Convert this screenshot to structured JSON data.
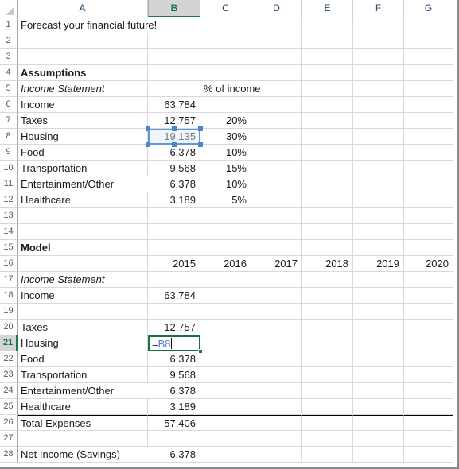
{
  "grid": {
    "columns": [
      {
        "label": "A",
        "active": false
      },
      {
        "label": "B",
        "active": true
      },
      {
        "label": "C",
        "active": false
      },
      {
        "label": "D",
        "active": false
      },
      {
        "label": "E",
        "active": false
      },
      {
        "label": "F",
        "active": false
      },
      {
        "label": "G",
        "active": false
      }
    ],
    "rows": [
      {
        "label": "1",
        "active": false
      },
      {
        "label": "2",
        "active": false
      },
      {
        "label": "3",
        "active": false
      },
      {
        "label": "4",
        "active": false
      },
      {
        "label": "5",
        "active": false
      },
      {
        "label": "6",
        "active": false
      },
      {
        "label": "7",
        "active": false
      },
      {
        "label": "8",
        "active": false
      },
      {
        "label": "9",
        "active": false
      },
      {
        "label": "10",
        "active": false
      },
      {
        "label": "11",
        "active": false
      },
      {
        "label": "12",
        "active": false
      },
      {
        "label": "13",
        "active": false
      },
      {
        "label": "14",
        "active": false
      },
      {
        "label": "15",
        "active": false
      },
      {
        "label": "16",
        "active": false
      },
      {
        "label": "17",
        "active": false
      },
      {
        "label": "18",
        "active": false
      },
      {
        "label": "19",
        "active": false
      },
      {
        "label": "20",
        "active": false
      },
      {
        "label": "21",
        "active": true
      },
      {
        "label": "22",
        "active": false
      },
      {
        "label": "23",
        "active": false
      },
      {
        "label": "24",
        "active": false
      },
      {
        "label": "25",
        "active": false
      },
      {
        "label": "26",
        "active": false
      },
      {
        "label": "27",
        "active": false
      },
      {
        "label": "28",
        "active": false
      }
    ]
  },
  "cells": {
    "A1": "Forecast your financial future!",
    "A4": "Assumptions",
    "A5": "Income Statement",
    "C5": "% of income",
    "A6": "Income",
    "B6": "63,784",
    "A7": "Taxes",
    "B7": "12,757",
    "C7": "20%",
    "A8": "Housing",
    "B8": "19,135",
    "C8": "30%",
    "A9": "Food",
    "B9": "6,378",
    "C9": "10%",
    "A10": "Transportation",
    "B10": "9,568",
    "C10": "15%",
    "A11": "Entertainment/Other",
    "B11": "6,378",
    "C11": "10%",
    "A12": "Healthcare",
    "B12": "3,189",
    "C12": "5%",
    "A15": "Model",
    "B16": "2015",
    "C16": "2016",
    "D16": "2017",
    "E16": "2018",
    "F16": "2019",
    "G16": "2020",
    "A17": "Income Statement",
    "A18": "Income",
    "B18": "63,784",
    "A20": "Taxes",
    "B20": "12,757",
    "A21": "Housing",
    "A22": "Food",
    "B22": "6,378",
    "A23": "Transportation",
    "B23": "9,568",
    "A24": "Entertainment/Other",
    "B24": "6,378",
    "A25": "Healthcare",
    "B25": "3,189",
    "A26": "Total Expenses",
    "B26": "57,406",
    "A28": "Net Income (Savings)",
    "B28": "6,378"
  },
  "editing": {
    "cell_ref": "B21",
    "equals_sign": "=",
    "reference": "B8"
  },
  "selection": {
    "copied_cell_ref": "B8"
  },
  "colors": {
    "accent_green": "#15713f",
    "selection_blue": "#5b9bd5",
    "formula_ref_blue": "#5b7ce0",
    "header_text": "#21476b",
    "gridline": "#d9d9d9"
  }
}
